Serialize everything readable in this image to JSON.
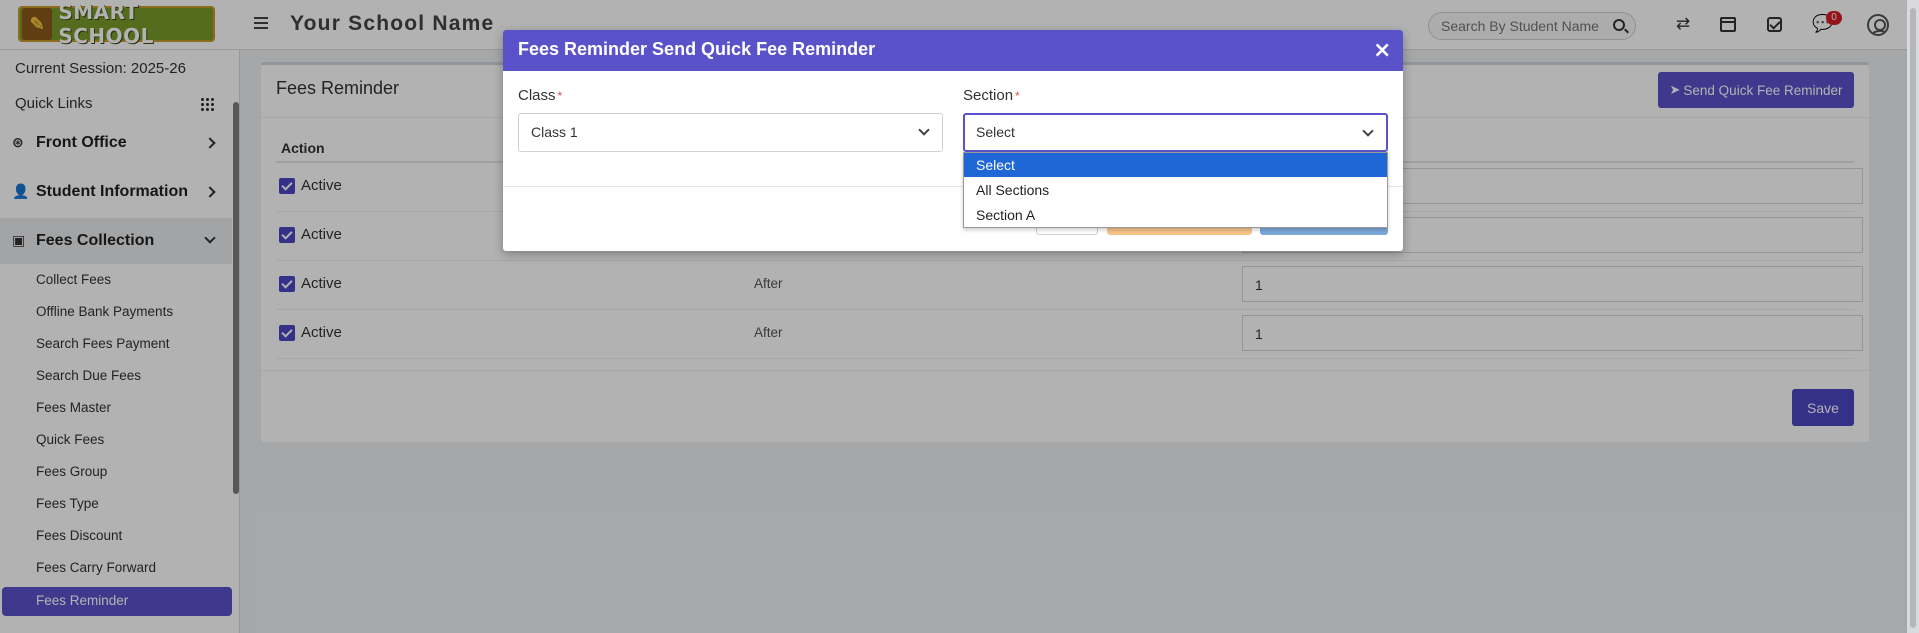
{
  "header": {
    "logo_text": "SMART SCHOOL",
    "school_name": "Your School Name",
    "search_placeholder": "Search By Student Name",
    "notification_count": "0"
  },
  "sidebar": {
    "session": "Current Session: 2025-26",
    "quick_links": "Quick Links",
    "menus": [
      {
        "label": "Front Office",
        "icon": "front-office-icon"
      },
      {
        "label": "Student Information",
        "icon": "user-add-icon"
      },
      {
        "label": "Fees Collection",
        "icon": "money-icon"
      }
    ],
    "sub_items": [
      "Collect Fees",
      "Offline Bank Payments",
      "Search Fees Payment",
      "Search Due Fees",
      "Fees Master",
      "Quick Fees",
      "Fees Group",
      "Fees Type",
      "Fees Discount",
      "Fees Carry Forward",
      "Fees Reminder"
    ]
  },
  "panel": {
    "title": "Fees Reminder",
    "send_button": "Send Quick Fee Reminder",
    "column_action": "Action",
    "rows": [
      {
        "status": "Active",
        "type": "",
        "days": ""
      },
      {
        "status": "Active",
        "type": "",
        "days": ""
      },
      {
        "status": "Active",
        "type": "After",
        "days": "1"
      },
      {
        "status": "Active",
        "type": "After",
        "days": "1"
      }
    ],
    "save_button": "Save"
  },
  "modal": {
    "title": "Fees Reminder Send Quick Fee Reminder",
    "close": "×",
    "class_label": "Class",
    "class_value": "Class 1",
    "section_label": "Section",
    "section_value": "Select",
    "required_mark": "*",
    "section_options": [
      "Select",
      "All Sections",
      "Section A"
    ]
  },
  "colors": {
    "primary": "#5a52c9",
    "selected_option": "#1f66d6",
    "badge": "#d61f26"
  }
}
